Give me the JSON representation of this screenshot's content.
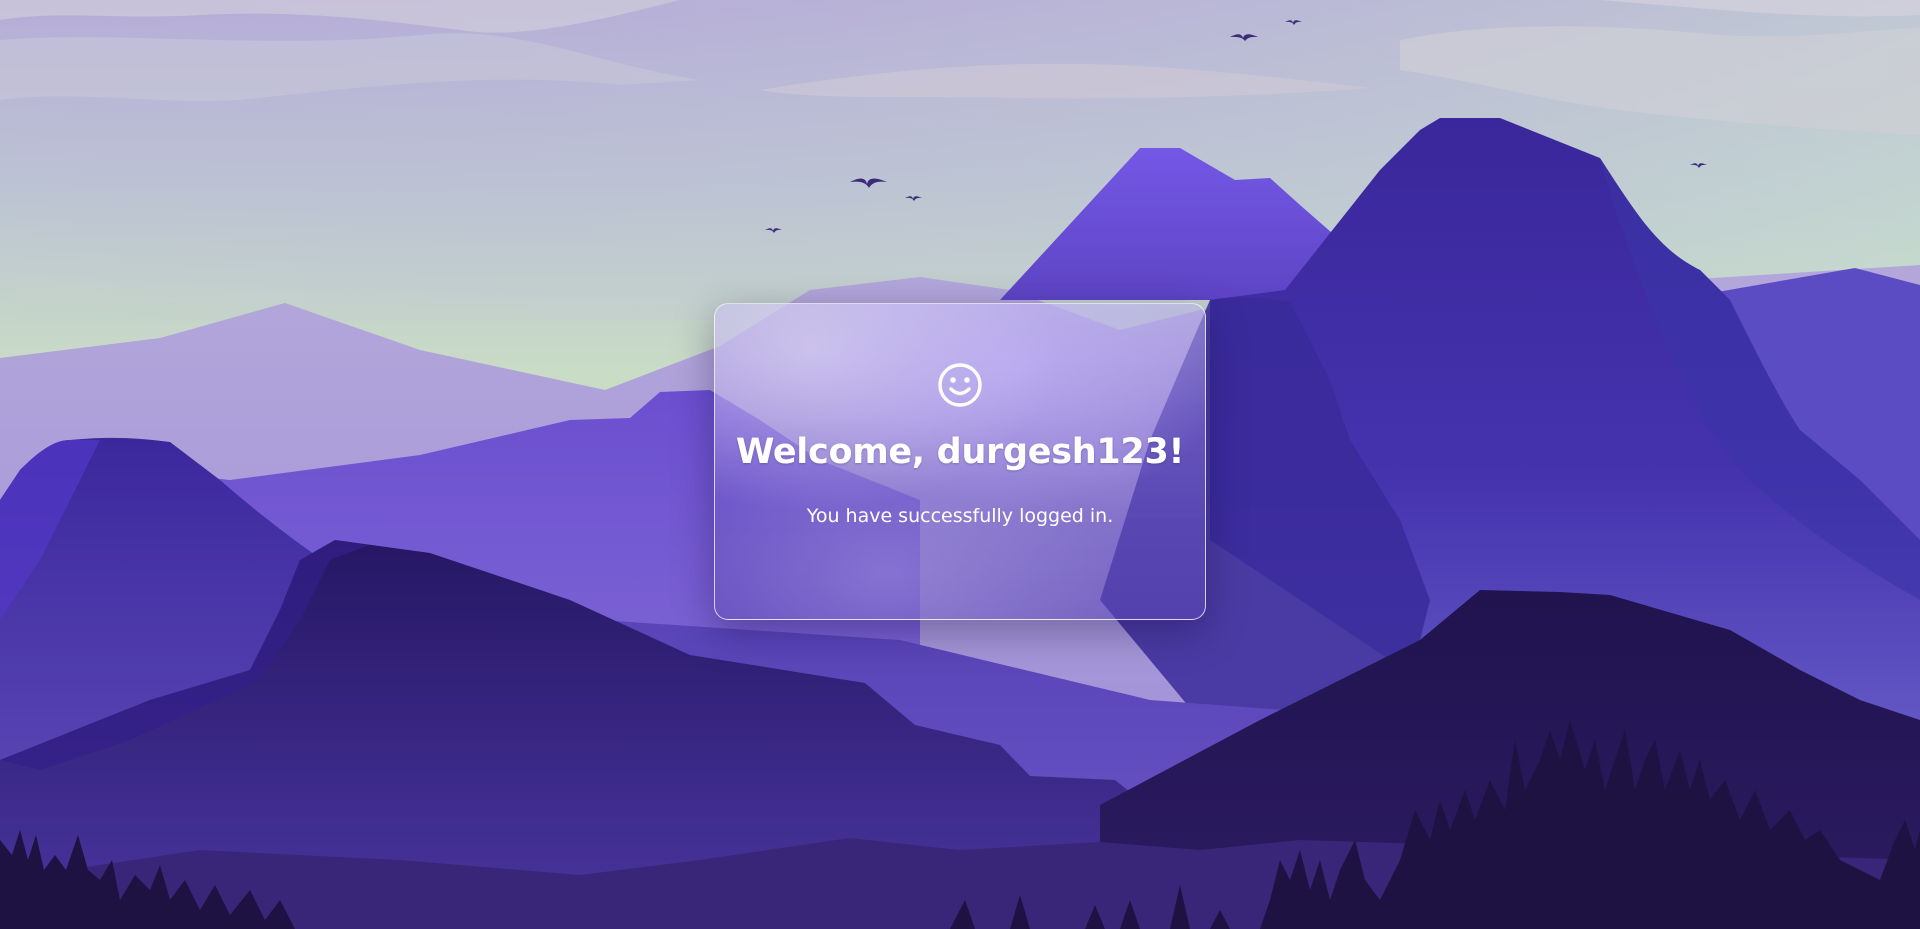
{
  "welcome": {
    "title": "Welcome, durgesh123!",
    "message": "You have successfully logged in.",
    "icon": "smile-icon"
  },
  "colors": {
    "sky_top": "#b3a9d9",
    "sky_bottom": "#c8dec4",
    "mountain_light": "#7a5ce8",
    "mountain_mid": "#3d2aa0",
    "mountain_dark": "#231650",
    "foreground": "#1a1038",
    "card_border": "#ffffff",
    "text": "#ffffff"
  }
}
